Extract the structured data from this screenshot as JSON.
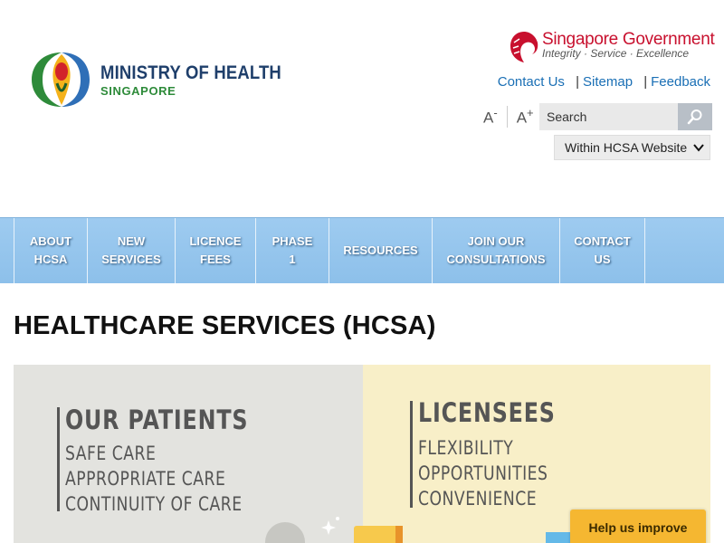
{
  "header": {
    "moh_logo": {
      "line1": "MINISTRY OF HEALTH",
      "line2": "SINGAPORE"
    },
    "sg_gov": {
      "name": "Singapore Government",
      "motto": "Integrity · Service · Excellence"
    },
    "links": [
      {
        "label": "Contact Us"
      },
      {
        "label": "Sitemap"
      },
      {
        "label": "Feedback"
      }
    ],
    "link_separator": "|",
    "font_decrease": {
      "letter": "A",
      "sign": "-"
    },
    "font_increase": {
      "letter": "A",
      "sign": "+"
    },
    "search": {
      "placeholder": "Search",
      "value": "Search"
    },
    "scope": {
      "selected": "Within HCSA Website"
    }
  },
  "nav": {
    "items": [
      {
        "label": "ABOUT\nHCSA"
      },
      {
        "label": "NEW\nSERVICES"
      },
      {
        "label": "LICENCE\nFEES"
      },
      {
        "label": "PHASE\n1"
      },
      {
        "label": "RESOURCES"
      },
      {
        "label": "JOIN OUR\nCONSULTATIONS"
      },
      {
        "label": "CONTACT\nUS"
      }
    ]
  },
  "main": {
    "title": "HEALTHCARE SERVICES (HCSA)",
    "banner": {
      "left": {
        "heading": "OUR PATIENTS",
        "lines": [
          "SAFE CARE",
          "APPROPRIATE CARE",
          "CONTINUITY OF CARE"
        ]
      },
      "right": {
        "heading": "LICENSEES",
        "lines": [
          "FLEXIBILITY",
          "OPPORTUNITIES",
          "CONVENIENCE"
        ]
      }
    }
  },
  "feedback_widget": {
    "label": "Help us improve"
  },
  "colors": {
    "nav_bg": "#93c5ed",
    "link": "#1a6fb5",
    "sg_red": "#c8102e",
    "help_button": "#f5b731"
  }
}
